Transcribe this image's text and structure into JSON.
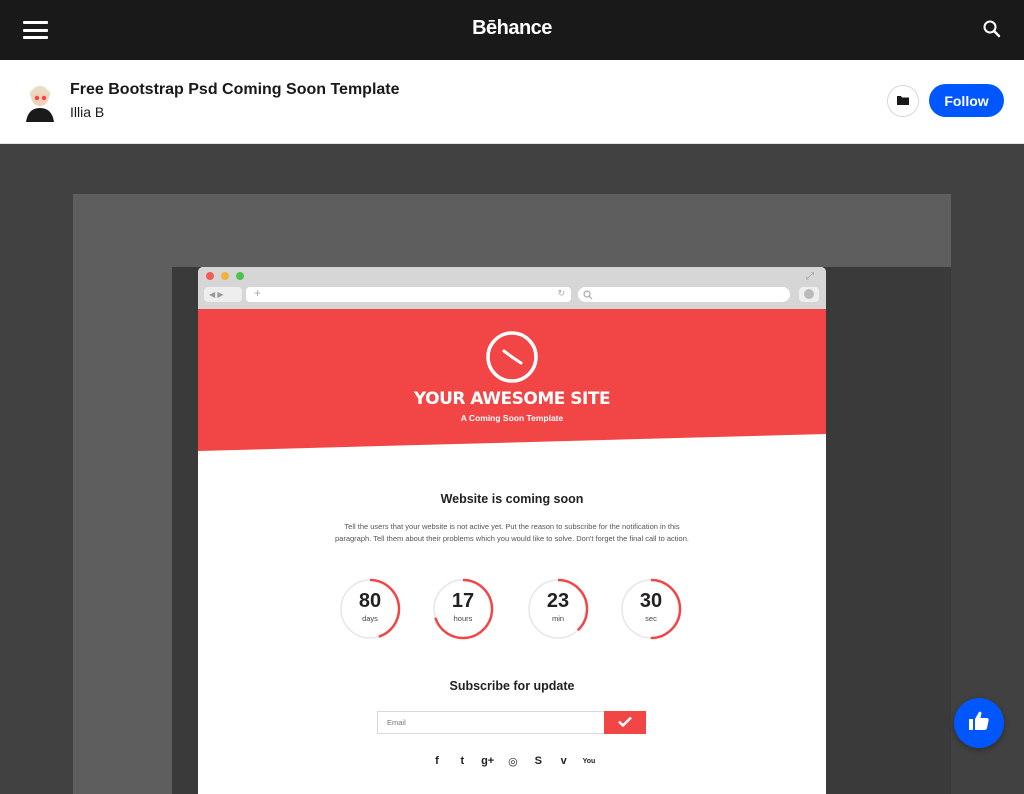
{
  "topbar": {
    "brand": "Bēhance",
    "menu_icon": "hamburger-menu-icon",
    "search_icon": "search-icon"
  },
  "project": {
    "title": "Free Bootstrap Psd Coming Soon Template",
    "owner": "Illia B",
    "save_icon": "folder-icon",
    "follow_label": "Follow"
  },
  "mockup": {
    "hero": {
      "title": "YOUR AWESOME SITE",
      "subtitle": "A Coming Soon Template",
      "icon": "clock-icon"
    },
    "coming_title": "Website is coming soon",
    "coming_text": "Tell the users that your website is not active yet. Put the reason to subscribe for the notification in this paragraph. Tell them about their problems which you would like to solve. Don't forget the final call to action.",
    "counters": [
      {
        "value": "80",
        "unit": "days",
        "progress": 0.45
      },
      {
        "value": "17",
        "unit": "hours",
        "progress": 0.7
      },
      {
        "value": "23",
        "unit": "min",
        "progress": 0.38
      },
      {
        "value": "30",
        "unit": "sec",
        "progress": 0.5
      }
    ],
    "subscribe_title": "Subscribe for update",
    "email_placeholder": "Email",
    "socials": [
      {
        "name": "facebook-icon",
        "glyph": "f"
      },
      {
        "name": "twitter-icon",
        "glyph": "t"
      },
      {
        "name": "google-plus-icon",
        "glyph": "g+"
      },
      {
        "name": "instagram-icon",
        "glyph": "◎"
      },
      {
        "name": "skype-icon",
        "glyph": "S"
      },
      {
        "name": "vimeo-icon",
        "glyph": "v"
      },
      {
        "name": "youtube-icon",
        "glyph": "You"
      }
    ]
  },
  "colors": {
    "accent_red": "#f24545",
    "behance_blue": "#0057ff",
    "topbar": "#191919"
  },
  "fab": {
    "icon": "thumbs-up-icon"
  }
}
